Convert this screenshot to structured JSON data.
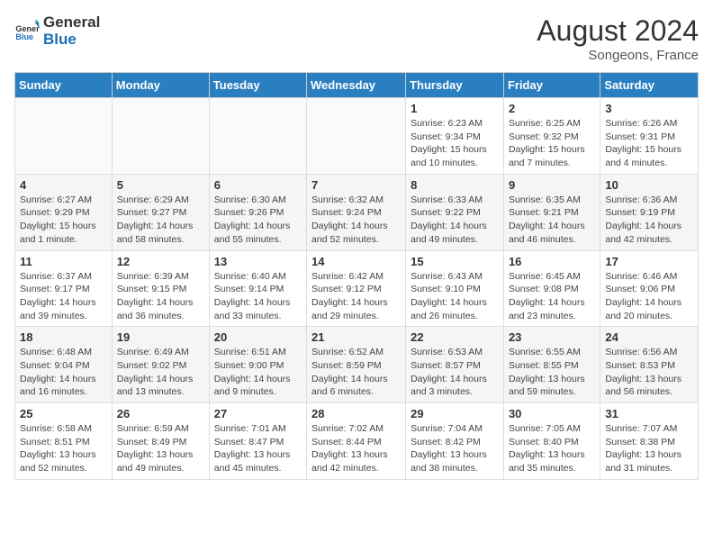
{
  "header": {
    "logo_general": "General",
    "logo_blue": "Blue",
    "month_year": "August 2024",
    "location": "Songeons, France"
  },
  "days_of_week": [
    "Sunday",
    "Monday",
    "Tuesday",
    "Wednesday",
    "Thursday",
    "Friday",
    "Saturday"
  ],
  "weeks": [
    [
      {
        "day": "",
        "info": ""
      },
      {
        "day": "",
        "info": ""
      },
      {
        "day": "",
        "info": ""
      },
      {
        "day": "",
        "info": ""
      },
      {
        "day": "1",
        "info": "Sunrise: 6:23 AM\nSunset: 9:34 PM\nDaylight: 15 hours\nand 10 minutes."
      },
      {
        "day": "2",
        "info": "Sunrise: 6:25 AM\nSunset: 9:32 PM\nDaylight: 15 hours\nand 7 minutes."
      },
      {
        "day": "3",
        "info": "Sunrise: 6:26 AM\nSunset: 9:31 PM\nDaylight: 15 hours\nand 4 minutes."
      }
    ],
    [
      {
        "day": "4",
        "info": "Sunrise: 6:27 AM\nSunset: 9:29 PM\nDaylight: 15 hours\nand 1 minute."
      },
      {
        "day": "5",
        "info": "Sunrise: 6:29 AM\nSunset: 9:27 PM\nDaylight: 14 hours\nand 58 minutes."
      },
      {
        "day": "6",
        "info": "Sunrise: 6:30 AM\nSunset: 9:26 PM\nDaylight: 14 hours\nand 55 minutes."
      },
      {
        "day": "7",
        "info": "Sunrise: 6:32 AM\nSunset: 9:24 PM\nDaylight: 14 hours\nand 52 minutes."
      },
      {
        "day": "8",
        "info": "Sunrise: 6:33 AM\nSunset: 9:22 PM\nDaylight: 14 hours\nand 49 minutes."
      },
      {
        "day": "9",
        "info": "Sunrise: 6:35 AM\nSunset: 9:21 PM\nDaylight: 14 hours\nand 46 minutes."
      },
      {
        "day": "10",
        "info": "Sunrise: 6:36 AM\nSunset: 9:19 PM\nDaylight: 14 hours\nand 42 minutes."
      }
    ],
    [
      {
        "day": "11",
        "info": "Sunrise: 6:37 AM\nSunset: 9:17 PM\nDaylight: 14 hours\nand 39 minutes."
      },
      {
        "day": "12",
        "info": "Sunrise: 6:39 AM\nSunset: 9:15 PM\nDaylight: 14 hours\nand 36 minutes."
      },
      {
        "day": "13",
        "info": "Sunrise: 6:40 AM\nSunset: 9:14 PM\nDaylight: 14 hours\nand 33 minutes."
      },
      {
        "day": "14",
        "info": "Sunrise: 6:42 AM\nSunset: 9:12 PM\nDaylight: 14 hours\nand 29 minutes."
      },
      {
        "day": "15",
        "info": "Sunrise: 6:43 AM\nSunset: 9:10 PM\nDaylight: 14 hours\nand 26 minutes."
      },
      {
        "day": "16",
        "info": "Sunrise: 6:45 AM\nSunset: 9:08 PM\nDaylight: 14 hours\nand 23 minutes."
      },
      {
        "day": "17",
        "info": "Sunrise: 6:46 AM\nSunset: 9:06 PM\nDaylight: 14 hours\nand 20 minutes."
      }
    ],
    [
      {
        "day": "18",
        "info": "Sunrise: 6:48 AM\nSunset: 9:04 PM\nDaylight: 14 hours\nand 16 minutes."
      },
      {
        "day": "19",
        "info": "Sunrise: 6:49 AM\nSunset: 9:02 PM\nDaylight: 14 hours\nand 13 minutes."
      },
      {
        "day": "20",
        "info": "Sunrise: 6:51 AM\nSunset: 9:00 PM\nDaylight: 14 hours\nand 9 minutes."
      },
      {
        "day": "21",
        "info": "Sunrise: 6:52 AM\nSunset: 8:59 PM\nDaylight: 14 hours\nand 6 minutes."
      },
      {
        "day": "22",
        "info": "Sunrise: 6:53 AM\nSunset: 8:57 PM\nDaylight: 14 hours\nand 3 minutes."
      },
      {
        "day": "23",
        "info": "Sunrise: 6:55 AM\nSunset: 8:55 PM\nDaylight: 13 hours\nand 59 minutes."
      },
      {
        "day": "24",
        "info": "Sunrise: 6:56 AM\nSunset: 8:53 PM\nDaylight: 13 hours\nand 56 minutes."
      }
    ],
    [
      {
        "day": "25",
        "info": "Sunrise: 6:58 AM\nSunset: 8:51 PM\nDaylight: 13 hours\nand 52 minutes."
      },
      {
        "day": "26",
        "info": "Sunrise: 6:59 AM\nSunset: 8:49 PM\nDaylight: 13 hours\nand 49 minutes."
      },
      {
        "day": "27",
        "info": "Sunrise: 7:01 AM\nSunset: 8:47 PM\nDaylight: 13 hours\nand 45 minutes."
      },
      {
        "day": "28",
        "info": "Sunrise: 7:02 AM\nSunset: 8:44 PM\nDaylight: 13 hours\nand 42 minutes."
      },
      {
        "day": "29",
        "info": "Sunrise: 7:04 AM\nSunset: 8:42 PM\nDaylight: 13 hours\nand 38 minutes."
      },
      {
        "day": "30",
        "info": "Sunrise: 7:05 AM\nSunset: 8:40 PM\nDaylight: 13 hours\nand 35 minutes."
      },
      {
        "day": "31",
        "info": "Sunrise: 7:07 AM\nSunset: 8:38 PM\nDaylight: 13 hours\nand 31 minutes."
      }
    ]
  ]
}
